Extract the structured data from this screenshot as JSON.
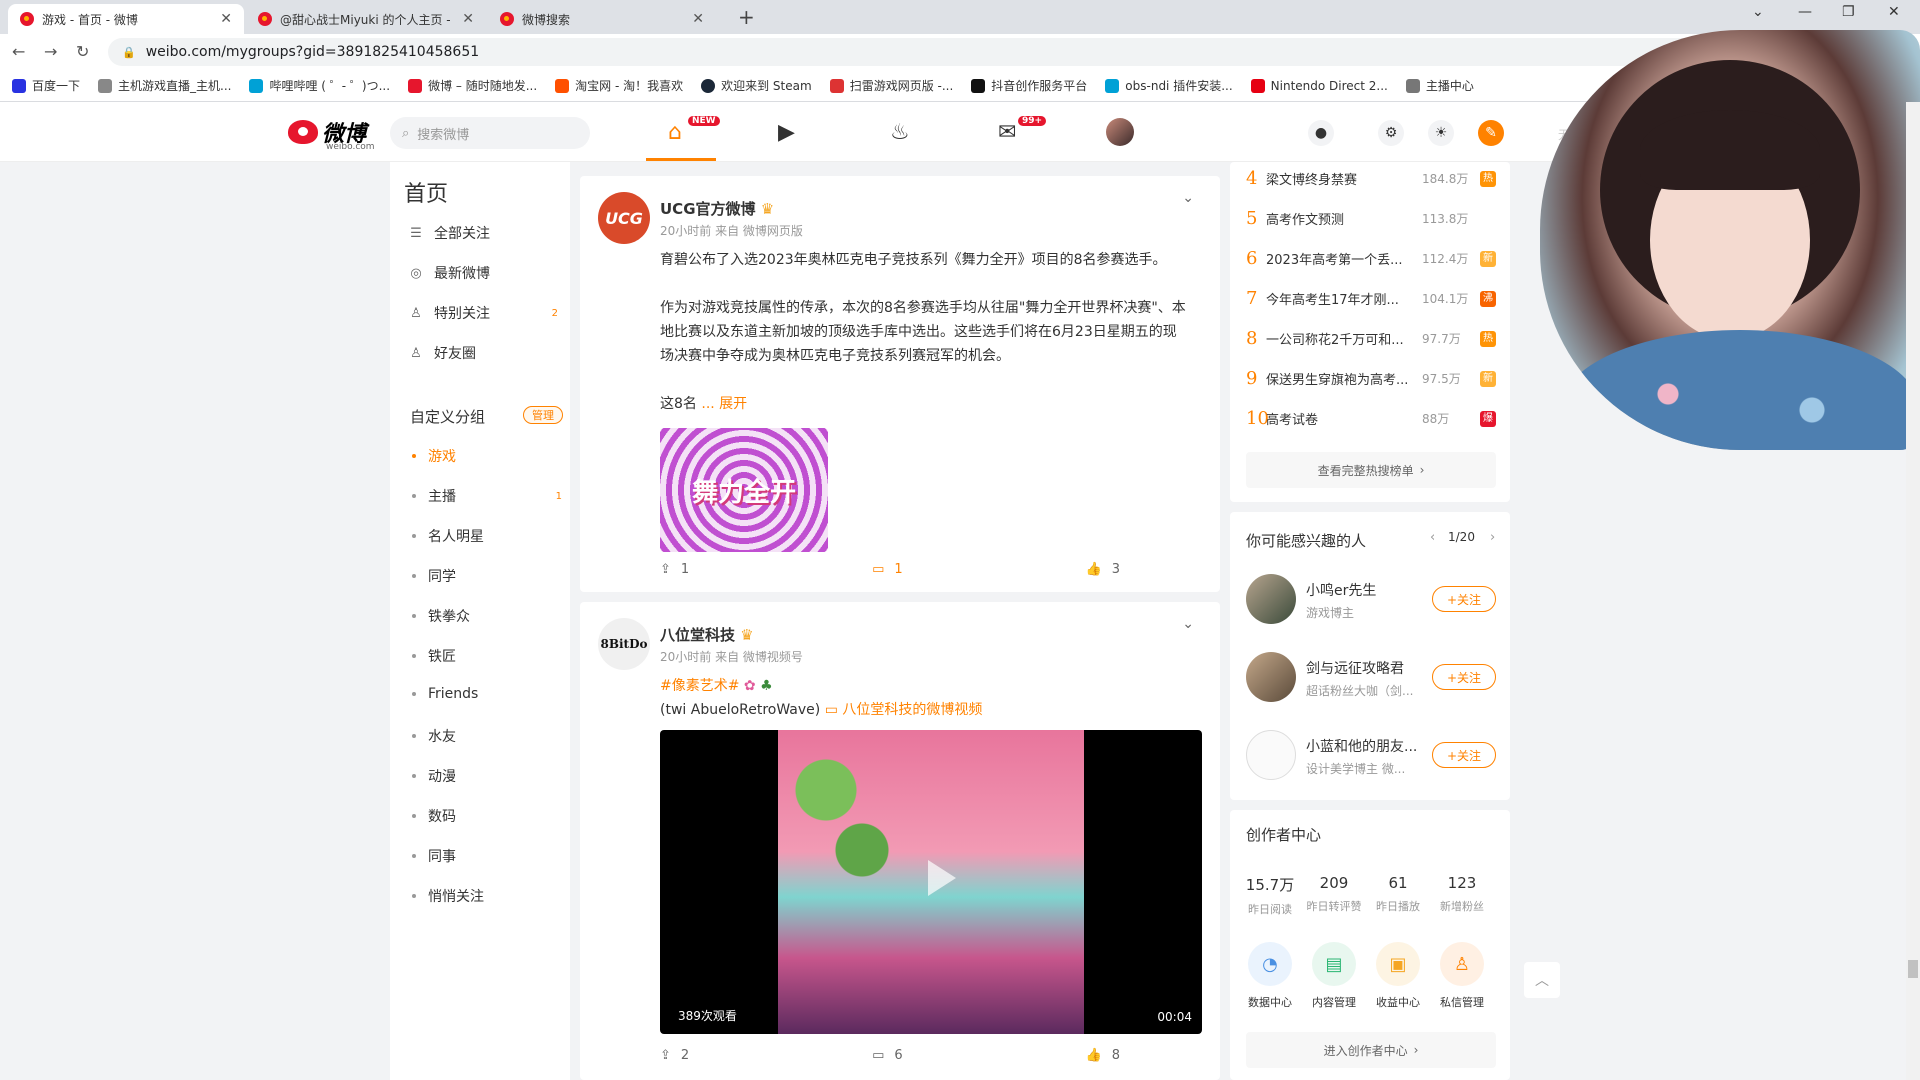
{
  "browser": {
    "tabs": [
      {
        "title": "游戏 - 首页 - 微博"
      },
      {
        "title": "@甜心战士Miyuki 的个人主页 -"
      },
      {
        "title": "微博搜索"
      }
    ],
    "url": "weibo.com/mygroups?gid=3891825410458651",
    "bookmarks": [
      "百度一下",
      "主机游戏直播_主机...",
      "哔哩哔哩 ( ゜- ゜)つ...",
      "微博 – 随时随地发...",
      "淘宝网 - 淘！我喜欢",
      "欢迎来到 Steam",
      "扫雷游戏网页版 -...",
      "抖音创作服务平台",
      "obs-ndi 插件安装...",
      "Nintendo Direct 2...",
      "主播中心"
    ]
  },
  "header": {
    "logo_text": "微博",
    "logo_sub": "weibo.com",
    "search_placeholder": "搜索微博",
    "home_badge": "NEW",
    "msg_badge": "99+",
    "extra": "无"
  },
  "left": {
    "title": "首页",
    "items": [
      {
        "label": "全部关注",
        "icon": "list-icon"
      },
      {
        "label": "最新微博",
        "icon": "latest-icon"
      },
      {
        "label": "特别关注",
        "icon": "special-follow-icon",
        "count": "2"
      },
      {
        "label": "好友圈",
        "icon": "friends-icon"
      }
    ],
    "section_title": "自定义分组",
    "manage_label": "管理",
    "groups": [
      {
        "label": "游戏",
        "active": true
      },
      {
        "label": "主播",
        "count": "1"
      },
      {
        "label": "名人明星"
      },
      {
        "label": "同学"
      },
      {
        "label": "铁拳众"
      },
      {
        "label": "铁匠"
      },
      {
        "label": "Friends"
      },
      {
        "label": "水友"
      },
      {
        "label": "动漫"
      },
      {
        "label": "数码"
      },
      {
        "label": "同事"
      },
      {
        "label": "悄悄关注"
      }
    ]
  },
  "posts": [
    {
      "author": "UCG官方微博",
      "avatar_text": "UCG",
      "meta": "20小时前 来自 微博网页版",
      "line1": "育碧公布了入选2023年奥林匹克电子竞技系列《舞力全开》项目的8名参赛选手。",
      "line2": "作为对游戏竞技属性的传承，本次的8名参赛选手均从往届\"舞力全开世界杯决赛\"、本地比赛以及东道主新加坡的顶级选手库中选出。这些选手们将在6月23日星期五的现场决赛中争夺成为奥林匹克电子竞技系列赛冠军的机会。",
      "line3": "这8名",
      "expand": "... 展开",
      "image_label": "舞力全开",
      "shares": "1",
      "comments": "1",
      "likes": "3"
    },
    {
      "author": "八位堂科技",
      "avatar_text": "8BitDo",
      "meta": "20小时前 来自 微博视频号",
      "hashtag": "#像素艺术#",
      "credit": "(twi AbueloRetroWave)",
      "video_link": "八位堂科技的微博视频",
      "views": "389次观看",
      "duration": "00:04",
      "shares": "2",
      "comments": "6",
      "likes": "8"
    }
  ],
  "hot": {
    "rows": [
      {
        "rank": "4",
        "title": "梁文博终身禁赛",
        "heat": "184.8万",
        "tag": "热",
        "tag_color": "#ff9406"
      },
      {
        "rank": "5",
        "title": "高考作文预测",
        "heat": "113.8万",
        "tag": "",
        "tag_color": ""
      },
      {
        "rank": "6",
        "title": "2023年高考第一个丢...",
        "heat": "112.4万",
        "tag": "新",
        "tag_color": "#ffb236"
      },
      {
        "rank": "7",
        "title": "今年高考生17年才刚...",
        "heat": "104.1万",
        "tag": "沸",
        "tag_color": "#f86400"
      },
      {
        "rank": "8",
        "title": "一公司称花2千万可和...",
        "heat": "97.7万",
        "tag": "热",
        "tag_color": "#ff9406"
      },
      {
        "rank": "9",
        "title": "保送男生穿旗袍为高考...",
        "heat": "97.5万",
        "tag": "新",
        "tag_color": "#ffb236"
      },
      {
        "rank": "10",
        "title": "高考试卷",
        "heat": "88万",
        "tag": "爆",
        "tag_color": "#e6162d"
      }
    ],
    "view_all": "查看完整热搜榜单"
  },
  "suggest": {
    "title": "你可能感兴趣的人",
    "page": "1/20",
    "people": [
      {
        "name": "小鸣er先生",
        "desc": "游戏博主",
        "follow": "+关注"
      },
      {
        "name": "剑与远征攻略君",
        "desc": "超话粉丝大咖（剑...",
        "follow": "+关注"
      },
      {
        "name": "小蓝和他的朋友...",
        "desc": "设计美学博主 微...",
        "follow": "+关注"
      }
    ]
  },
  "creator": {
    "title": "创作者中心",
    "stats": [
      {
        "value": "15.7万",
        "label": "昨日阅读"
      },
      {
        "value": "209",
        "label": "昨日转评赞"
      },
      {
        "value": "61",
        "label": "昨日播放"
      },
      {
        "value": "123",
        "label": "新增粉丝"
      }
    ],
    "tools": [
      {
        "label": "数据中心",
        "icon": "data-center-icon",
        "color": "#4a90e2"
      },
      {
        "label": "内容管理",
        "icon": "content-manage-icon",
        "color": "#2bb673"
      },
      {
        "label": "收益中心",
        "icon": "revenue-icon",
        "color": "#f5a623"
      },
      {
        "label": "私信管理",
        "icon": "message-manage-icon",
        "color": "#ff8200"
      }
    ],
    "enter": "进入创作者中心"
  }
}
